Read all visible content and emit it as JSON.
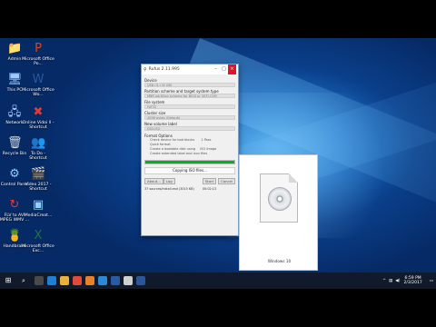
{
  "desktop_icons": [
    {
      "label": "Admin",
      "icon": "user-folder-icon"
    },
    {
      "label": "Microsoft Office Po...",
      "icon": "powerpoint-icon"
    },
    {
      "label": "This PC",
      "icon": "computer-icon"
    },
    {
      "label": "Microsoft Office Wo...",
      "icon": "word-icon"
    },
    {
      "label": "Network",
      "icon": "network-icon"
    },
    {
      "label": "Online Vidoi ll - Shortcut",
      "icon": "shortcut-x-icon"
    },
    {
      "label": "Recycle Bin",
      "icon": "recycle-bin-icon"
    },
    {
      "label": "To Do - Shortcut",
      "icon": "people-icon"
    },
    {
      "label": "Control Panel",
      "icon": "control-panel-icon"
    },
    {
      "label": "Video 2017 - Shortcut",
      "icon": "video-shortcut-icon"
    },
    {
      "label": "FLV to AVI MPEG WMV ...",
      "icon": "converter-icon"
    },
    {
      "label": "MediaCreat...",
      "icon": "media-creation-icon"
    },
    {
      "label": "Handbrake",
      "icon": "handbrake-icon"
    },
    {
      "label": "Microsoft Office Exc...",
      "icon": "excel-icon"
    }
  ],
  "rufus": {
    "title": "Rufus 2.11.995",
    "device_label": "Device",
    "device_value": "USB (G:) [8 GB]",
    "partition_label": "Partition scheme and target system type",
    "partition_value": "MBR partition scheme for BIOS or UEFI-CSM",
    "fs_label": "File system",
    "fs_value": "FAT32",
    "cluster_label": "Cluster size",
    "cluster_value": "4096 bytes (Default)",
    "volume_label": "New volume label",
    "volume_value": "ESD-ISO",
    "format_options": "Format Options",
    "opt_bad_blocks": "Check device for bad blocks",
    "opt_bad_blocks_value": "1 Pass",
    "opt_quick": "Quick format",
    "opt_bootable": "Create a bootable disk using",
    "opt_bootable_value": "ISO Image",
    "opt_extended": "Create extended label and icon files",
    "progress": 1.0,
    "status": "Copying ISO files...",
    "btn_about": "About...",
    "btn_log": "Log",
    "btn_start": "Start",
    "btn_cancel": "Cancel",
    "footer": "37 sources/install.esd (3015 KB)",
    "footer_time": "00:02:13"
  },
  "iso_file": {
    "name": "Windows 10",
    "icon": "disc-image-icon"
  },
  "taskbar": {
    "start_icon": "windows-start-icon",
    "search_icon": "search-icon",
    "pinned": [
      {
        "icon": "task-view-icon",
        "color": "#4a4a4a"
      },
      {
        "icon": "edge-icon",
        "color": "#1e7fd6"
      },
      {
        "icon": "file-explorer-icon",
        "color": "#e8b23a"
      },
      {
        "icon": "chrome-icon",
        "color": "#e04a3a"
      },
      {
        "icon": "firefox-icon",
        "color": "#e8822a"
      },
      {
        "icon": "store-icon",
        "color": "#2a8ad6"
      },
      {
        "icon": "photoshop-icon",
        "color": "#2a5aa6"
      },
      {
        "icon": "rufus-icon",
        "color": "#cfcfcf"
      },
      {
        "icon": "word-icon",
        "color": "#2b579a"
      }
    ],
    "time": "6:59 PM",
    "date": "2/3/2017"
  }
}
